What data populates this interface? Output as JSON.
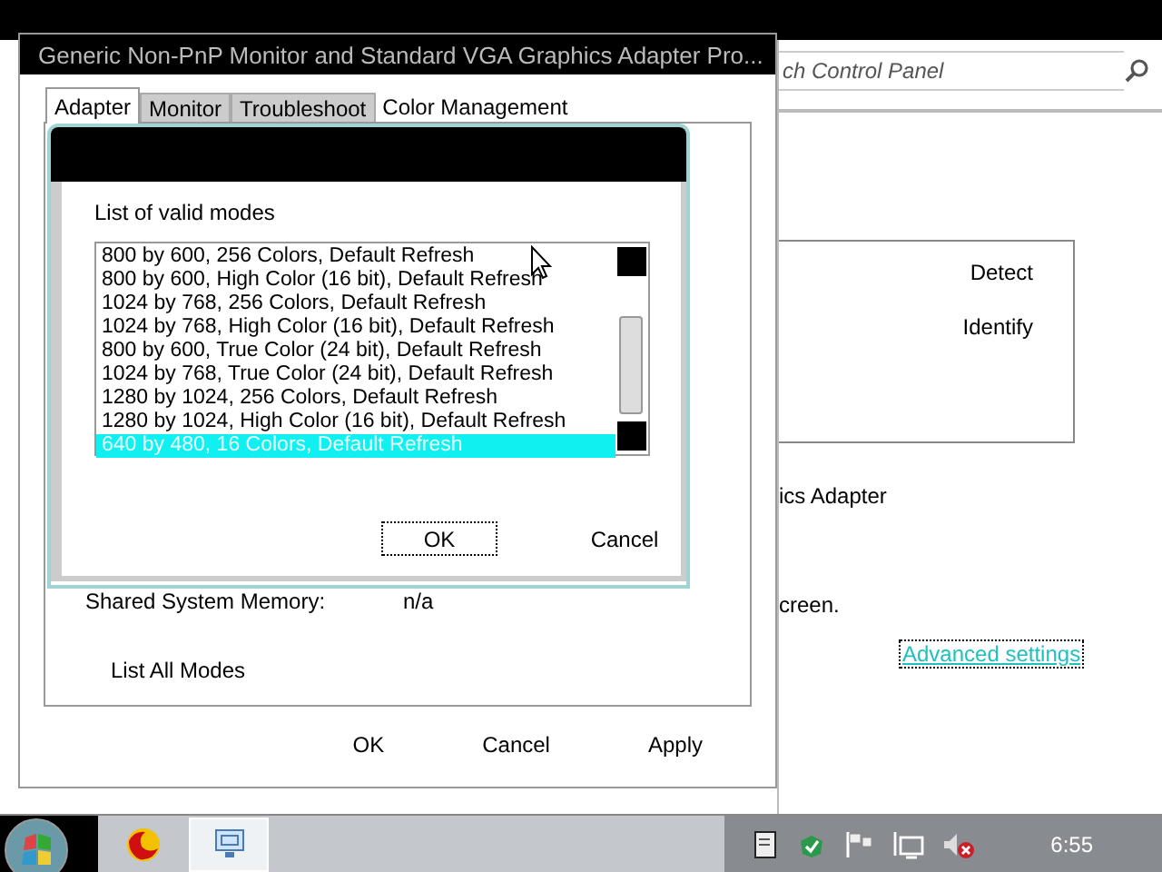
{
  "control_panel": {
    "search": {
      "placeholder": "ch Control Panel"
    },
    "buttons": [
      "Detect",
      "Identify"
    ],
    "adapter_text": "ics Adapter",
    "screen_text": "creen.",
    "link": {
      "label": "Advanced settings",
      "focused": true
    }
  },
  "properties_window": {
    "title": "Generic Non-PnP Monitor and Standard VGA Graphics Adapter Pro...",
    "tabs": [
      {
        "label": "Adapter",
        "selected": true
      },
      {
        "label": "Monitor",
        "selected": false
      },
      {
        "label": "Troubleshoot",
        "selected": false
      },
      {
        "label": "Color Management",
        "selected": false
      }
    ],
    "shared_memory": {
      "label": "Shared System Memory:",
      "value": "n/a"
    },
    "list_all_modes": "List All Modes",
    "buttons": [
      "OK",
      "Cancel",
      "Apply"
    ]
  },
  "modes_dialog": {
    "label": "List of valid modes",
    "modes": [
      {
        "label": "800 by 600, 256 Colors, Default Refresh",
        "selected": false
      },
      {
        "label": "800 by 600, High Color (16 bit), Default Refresh",
        "selected": false
      },
      {
        "label": "1024 by 768, 256 Colors, Default Refresh",
        "selected": false
      },
      {
        "label": "1024 by 768, High Color (16 bit), Default Refresh",
        "selected": false
      },
      {
        "label": "800 by 600, True Color (24 bit), Default Refresh",
        "selected": false
      },
      {
        "label": "1024 by 768, True Color (24 bit), Default Refresh",
        "selected": false
      },
      {
        "label": "1280 by 1024, 256 Colors, Default Refresh",
        "selected": false
      },
      {
        "label": "1280 by 1024, High Color (16 bit), Default Refresh",
        "selected": false
      },
      {
        "label": "640 by 480, 16 Colors, Default Refresh",
        "selected": true
      }
    ],
    "buttons": [
      {
        "label": "OK",
        "focused": true
      },
      {
        "label": "Cancel",
        "focused": false
      }
    ]
  },
  "taskbar": {
    "clock": "6:55"
  }
}
